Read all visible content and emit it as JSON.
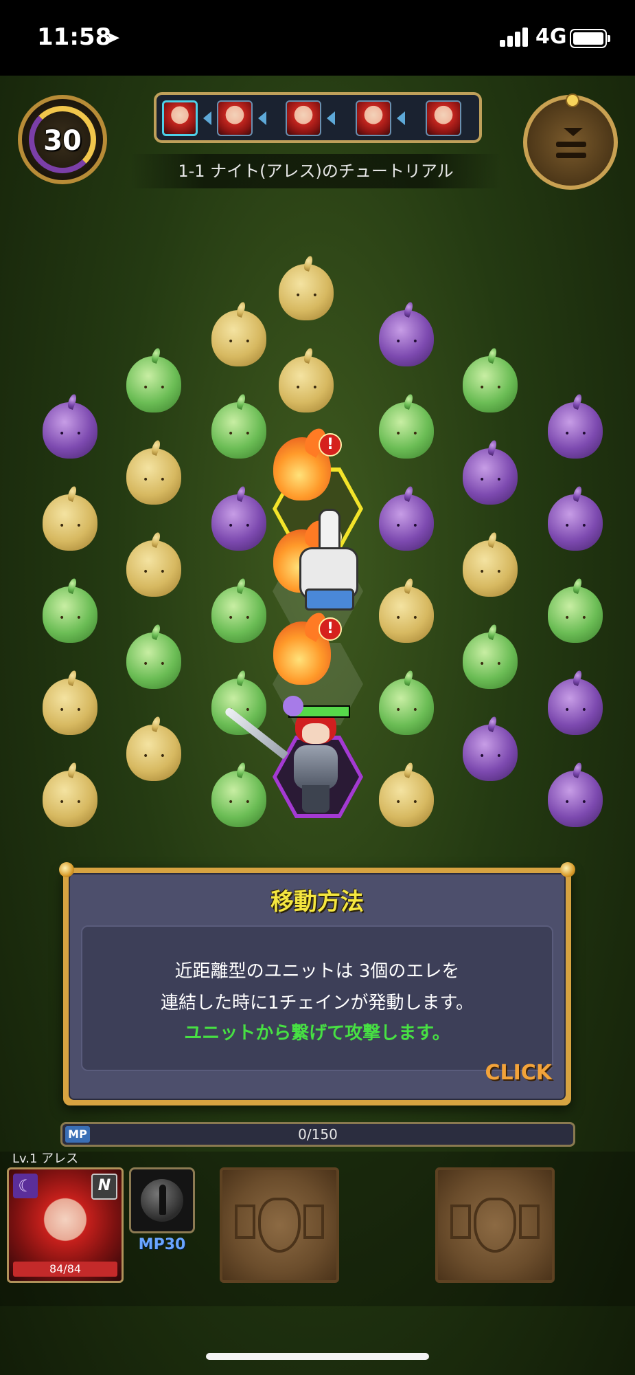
{
  "status_bar": {
    "time": "11:58",
    "network": "4G"
  },
  "hud": {
    "turns_left": "30",
    "stage_title": "1-1 ナイト(アレス)のチュートリアル",
    "queue_count": 5
  },
  "board": {
    "rows": [
      [
        "",
        "",
        "",
        "yellow",
        "",
        "",
        ""
      ],
      [
        "",
        "",
        "yellow",
        "",
        "purple",
        "",
        ""
      ],
      [
        "",
        "green",
        "",
        "yellow",
        "",
        "green",
        ""
      ],
      [
        "purple",
        "",
        "green",
        "",
        "green",
        "",
        "purple"
      ],
      [
        "",
        "yellow",
        "",
        "fire",
        "",
        "purple",
        ""
      ],
      [
        "yellow",
        "",
        "purple",
        "",
        "purple",
        "",
        "purple"
      ],
      [
        "",
        "yellow",
        "",
        "fire",
        "",
        "yellow",
        ""
      ],
      [
        "green",
        "",
        "green",
        "",
        "yellow",
        "",
        "green"
      ],
      [
        "",
        "green",
        "",
        "fire",
        "",
        "green",
        ""
      ],
      [
        "yellow",
        "",
        "green",
        "",
        "green",
        "",
        "purple"
      ],
      [
        "",
        "yellow",
        "",
        "hero",
        "",
        "purple",
        ""
      ],
      [
        "yellow",
        "",
        "green",
        "",
        "yellow",
        "",
        "purple"
      ]
    ]
  },
  "dialog": {
    "title": "移動方法",
    "line1": "近距離型のユニットは 3個のエレを",
    "line2": "連結した時に1チェインが発動します。",
    "line3": "ユニットから繋げて攻撃します。",
    "click_label": "CLICK"
  },
  "mp": {
    "tag": "MP",
    "text": "0/150",
    "fraction": 0
  },
  "unit": {
    "level_name": "Lv.1 アレス",
    "rank": "N",
    "hp_text": "84/84",
    "skill_cost": "MP30"
  },
  "colors": {
    "accent_gold": "#d7a341",
    "dialog_title": "#f4e640",
    "highlight_green": "#47e043",
    "click_orange": "#f3a33a"
  }
}
